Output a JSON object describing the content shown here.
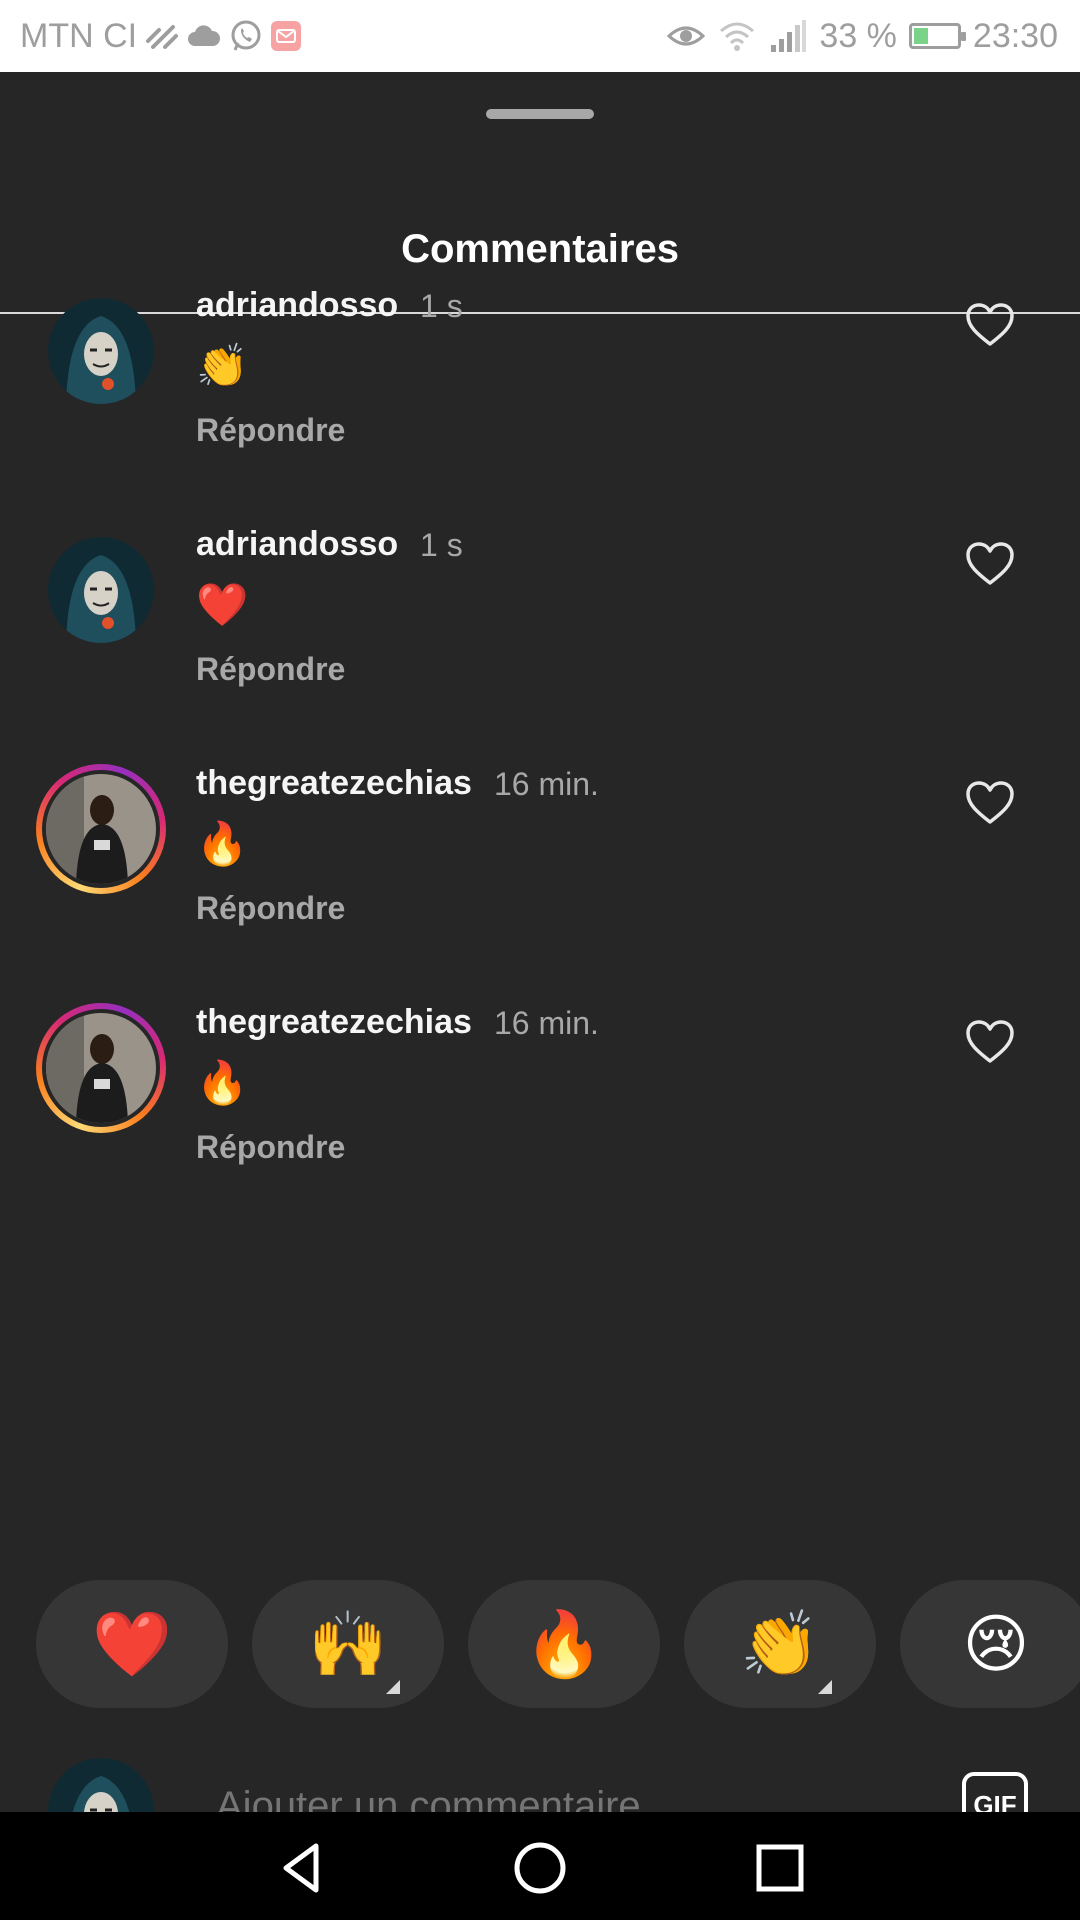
{
  "status_bar": {
    "carrier": "MTN CI",
    "battery_percent": "33 %",
    "battery_level": 0.33,
    "time": "23:30",
    "icons": [
      "missed-call-icon",
      "cloud-icon",
      "whatsapp-icon",
      "mail-icon",
      "eye-icon",
      "wifi-icon",
      "signal-icon",
      "battery-icon"
    ]
  },
  "sheet": {
    "title": "Commentaires"
  },
  "comments": [
    {
      "username": "adriandosso",
      "time": "1 s",
      "text": "👏",
      "reply_label": "Répondre",
      "story_ring": false
    },
    {
      "username": "adriandosso",
      "time": "1 s",
      "text": "❤️",
      "reply_label": "Répondre",
      "story_ring": false
    },
    {
      "username": "thegreatezechias",
      "time": "16 min.",
      "text": "🔥",
      "reply_label": "Répondre",
      "story_ring": true
    },
    {
      "username": "thegreatezechias",
      "time": "16 min.",
      "text": "🔥",
      "reply_label": "Répondre",
      "story_ring": true
    }
  ],
  "reactions": [
    "❤️",
    "🙌",
    "🔥",
    "👏",
    "😢"
  ],
  "composer": {
    "placeholder": "Ajouter un commentaire...",
    "gif_label": "GIF"
  },
  "colors": {
    "background": "#262626",
    "secondary_text": "#a8a8a8",
    "heart": "#ed4f8a"
  }
}
